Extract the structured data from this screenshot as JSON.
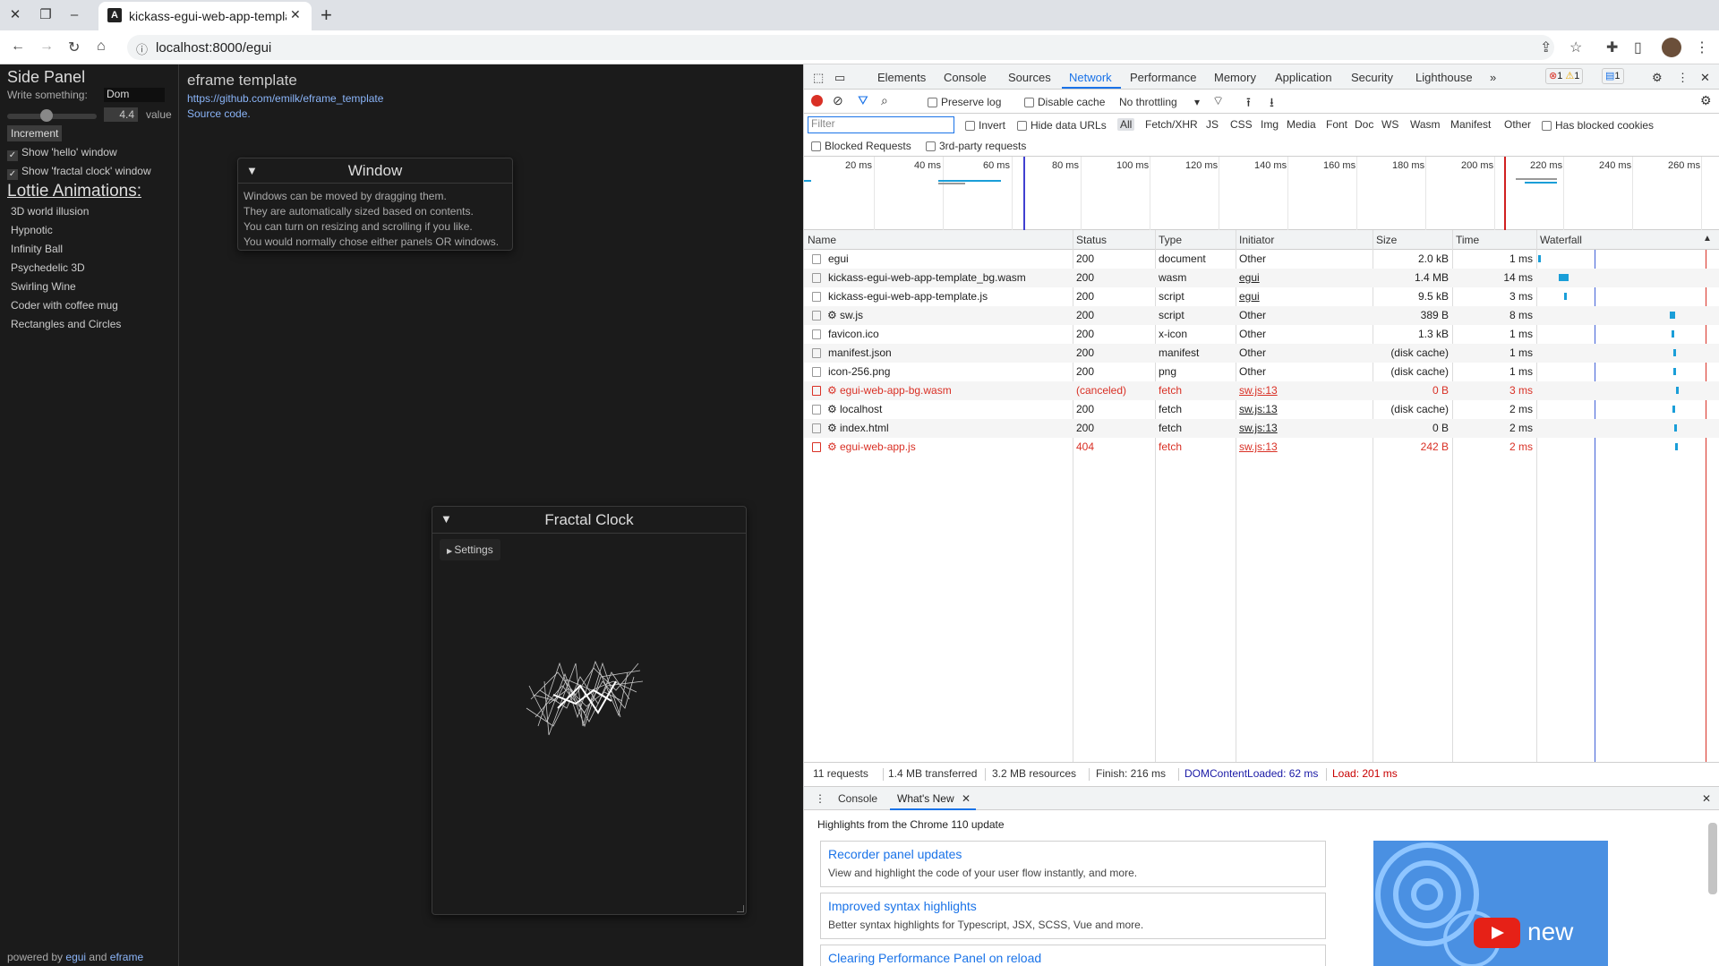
{
  "browser": {
    "tab_title": "kickass-egui-web-app-templa",
    "url": "localhost:8000/egui"
  },
  "app": {
    "side_panel": {
      "title": "Side Panel",
      "write_label": "Write something:",
      "write_value": "Dom",
      "slider_value": "4.4",
      "slider_unit": "value",
      "slider_fraction": 0.44,
      "increment_label": "Increment",
      "show_hello": "Show 'hello' window",
      "show_clock": "Show 'fractal clock' window",
      "lottie_heading": "Lottie Animations:",
      "lottie_items": [
        "3D world illusion",
        "Hypnotic",
        "Infinity Ball",
        "Psychedelic 3D",
        "Swirling Wine",
        "Coder with coffee mug",
        "Rectangles and Circles"
      ],
      "powered_prefix": "powered by",
      "powered_egui": "egui",
      "powered_and": "and",
      "powered_eframe": "eframe"
    },
    "central": {
      "title": "eframe template",
      "repo_link": "https://github.com/emilk/eframe_template",
      "source_link": "Source code."
    },
    "window": {
      "title": "Window",
      "lines": [
        "Windows can be moved by dragging them.",
        "They are automatically sized based on contents.",
        "You can turn on resizing and scrolling if you like.",
        "You would normally chose either panels OR windows."
      ]
    },
    "fractal_clock": {
      "title": "Fractal Clock",
      "settings_label": "Settings"
    }
  },
  "devtools": {
    "tabs": [
      "Elements",
      "Console",
      "Sources",
      "Network",
      "Performance",
      "Memory",
      "Application",
      "Security",
      "Lighthouse"
    ],
    "active_tab": "Network",
    "more": "»",
    "badges": {
      "errors": "1",
      "warnings": "1",
      "messages": "1"
    },
    "toolbar": {
      "preserve_log": "Preserve log",
      "disable_cache": "Disable cache",
      "throttling": "No throttling",
      "filter_placeholder": "Filter",
      "invert": "Invert",
      "hide_data_urls": "Hide data URLs",
      "types": [
        "All",
        "Fetch/XHR",
        "JS",
        "CSS",
        "Img",
        "Media",
        "Font",
        "Doc",
        "WS",
        "Wasm",
        "Manifest",
        "Other"
      ],
      "has_blocked_cookies": "Has blocked cookies",
      "blocked_requests": "Blocked Requests",
      "third_party": "3rd-party requests"
    },
    "overview_ticks": [
      "20 ms",
      "40 ms",
      "60 ms",
      "80 ms",
      "100 ms",
      "120 ms",
      "140 ms",
      "160 ms",
      "180 ms",
      "200 ms",
      "220 ms",
      "240 ms",
      "260 ms"
    ],
    "columns": [
      "Name",
      "Status",
      "Type",
      "Initiator",
      "Size",
      "Time",
      "Waterfall"
    ],
    "rows": [
      {
        "name": "egui",
        "status": "200",
        "type": "document",
        "initiator": "Other",
        "size": "2.0 kB",
        "time": "1 ms",
        "error": false,
        "sw": false,
        "link": false
      },
      {
        "name": "kickass-egui-web-app-template_bg.wasm",
        "status": "200",
        "type": "wasm",
        "initiator": "egui",
        "size": "1.4 MB",
        "time": "14 ms",
        "error": false,
        "sw": false,
        "link": true
      },
      {
        "name": "kickass-egui-web-app-template.js",
        "status": "200",
        "type": "script",
        "initiator": "egui",
        "size": "9.5 kB",
        "time": "3 ms",
        "error": false,
        "sw": false,
        "link": true
      },
      {
        "name": "sw.js",
        "status": "200",
        "type": "script",
        "initiator": "Other",
        "size": "389 B",
        "time": "8 ms",
        "error": false,
        "sw": true,
        "link": false
      },
      {
        "name": "favicon.ico",
        "status": "200",
        "type": "x-icon",
        "initiator": "Other",
        "size": "1.3 kB",
        "time": "1 ms",
        "error": false,
        "sw": false,
        "link": false
      },
      {
        "name": "manifest.json",
        "status": "200",
        "type": "manifest",
        "initiator": "Other",
        "size": "(disk cache)",
        "time": "1 ms",
        "error": false,
        "sw": false,
        "link": false
      },
      {
        "name": "icon-256.png",
        "status": "200",
        "type": "png",
        "initiator": "Other",
        "size": "(disk cache)",
        "time": "1 ms",
        "error": false,
        "sw": false,
        "link": false
      },
      {
        "name": "egui-web-app-bg.wasm",
        "status": "(canceled)",
        "type": "fetch",
        "initiator": "sw.js:13",
        "size": "0 B",
        "time": "3 ms",
        "error": true,
        "sw": true,
        "link": true
      },
      {
        "name": "localhost",
        "status": "200",
        "type": "fetch",
        "initiator": "sw.js:13",
        "size": "(disk cache)",
        "time": "2 ms",
        "error": false,
        "sw": true,
        "link": true
      },
      {
        "name": "index.html",
        "status": "200",
        "type": "fetch",
        "initiator": "sw.js:13",
        "size": "0 B",
        "time": "2 ms",
        "error": false,
        "sw": true,
        "link": true
      },
      {
        "name": "egui-web-app.js",
        "status": "404",
        "type": "fetch",
        "initiator": "sw.js:13",
        "size": "242 B",
        "time": "2 ms",
        "error": true,
        "sw": true,
        "link": true
      }
    ],
    "status_bar": {
      "requests": "11 requests",
      "transferred": "1.4 MB transferred",
      "resources": "3.2 MB resources",
      "finish": "Finish: 216 ms",
      "dcl": "DOMContentLoaded: 62 ms",
      "load": "Load: 201 ms"
    },
    "drawer": {
      "tabs": [
        "Console",
        "What's New"
      ],
      "highlights_title": "Highlights from the Chrome 110 update",
      "cards": [
        {
          "title": "Recorder panel updates",
          "desc": "View and highlight the code of your user flow instantly, and more."
        },
        {
          "title": "Improved syntax highlights",
          "desc": "Better syntax highlights for Typescript, JSX, SCSS, Vue and more."
        },
        {
          "title": "Clearing Performance Panel on reload",
          "desc": ""
        }
      ],
      "video_text": "new"
    }
  },
  "colors": {
    "accent": "#1a73e8",
    "error": "#d93025",
    "egui_bg": "#1b1b1b",
    "link": "#8ab4f8",
    "dcl": "#1a1aa6",
    "load": "#c80000"
  }
}
